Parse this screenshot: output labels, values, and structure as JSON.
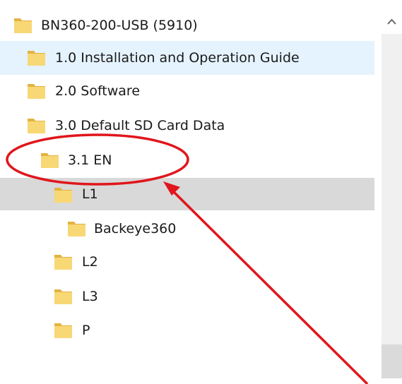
{
  "tree": {
    "nodes": [
      {
        "label": "BN360-200-USB (5910)",
        "state": "normal"
      },
      {
        "label": "1.0 Installation and Operation Guide",
        "state": "hover"
      },
      {
        "label": "2.0 Software",
        "state": "normal"
      },
      {
        "label": "3.0 Default SD Card Data",
        "state": "normal"
      },
      {
        "label": "3.1 EN",
        "state": "normal"
      },
      {
        "label": "L1",
        "state": "selected"
      },
      {
        "label": "Backeye360",
        "state": "normal"
      },
      {
        "label": "L2",
        "state": "normal"
      },
      {
        "label": "L3",
        "state": "normal"
      },
      {
        "label": "P",
        "state": "normal"
      }
    ]
  },
  "scrollbar": {
    "up_icon": "chevron-up-icon"
  },
  "annotation": {
    "color": "#e0161c",
    "shapes": [
      "ellipse-highlight",
      "arrow-pointer"
    ]
  },
  "colors": {
    "folder_fill": "#f8d775",
    "folder_shade": "#e3b341",
    "hover_bg": "#e5f3ff",
    "selected_bg": "#d9d9d9"
  }
}
